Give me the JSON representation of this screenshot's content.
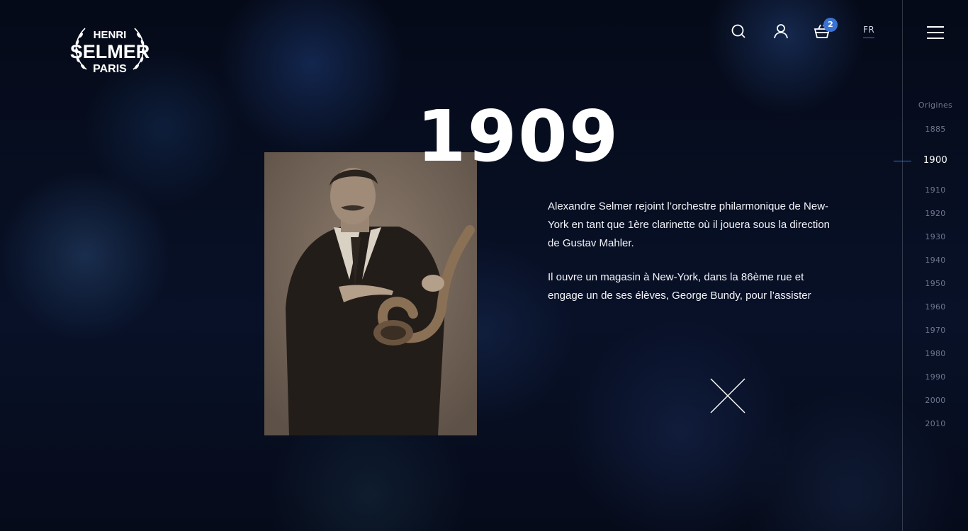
{
  "brand": {
    "logo_top": "HENRI",
    "logo_middle": "SELMER",
    "logo_bottom": "PARIS"
  },
  "header": {
    "cart_count": "2",
    "language": "FR",
    "icons": [
      "search-icon",
      "user-icon",
      "cart-icon",
      "menu-icon"
    ]
  },
  "content": {
    "year": "1909",
    "paragraphs": [
      "Alexandre Selmer rejoint l’orchestre philarmonique de New-York en tant que 1ère clarinette où il jouera sous la direction de Gustav Mahler.",
      "Il ouvre un magasin à New-York, dans la 86ème rue et engage un de ses élèves, George Bundy, pour l’assister"
    ]
  },
  "timeline": {
    "items": [
      "Origines",
      "1885",
      "1900",
      "1910",
      "1920",
      "1930",
      "1940",
      "1950",
      "1960",
      "1970",
      "1980",
      "1990",
      "2000",
      "2010"
    ],
    "active": "1900"
  },
  "colors": {
    "accent": "#3a73d6",
    "background": "#060b1a",
    "inactive_text": "#6f7890"
  }
}
